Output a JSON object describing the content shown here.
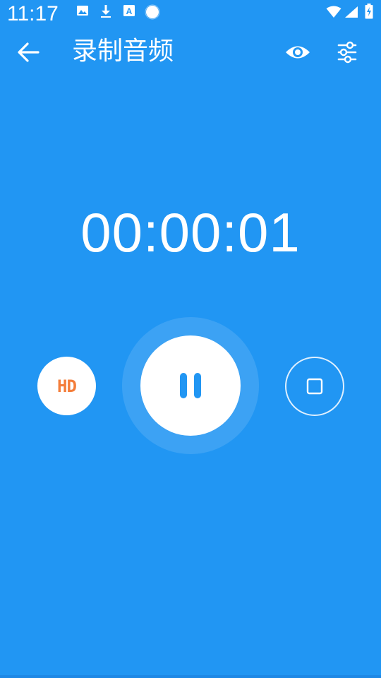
{
  "status_bar": {
    "time": "11:17",
    "icons": [
      "image-icon",
      "download-icon",
      "text-a-icon",
      "circle-dot-icon",
      "wifi-icon",
      "signal-icon",
      "battery-icon"
    ]
  },
  "app_bar": {
    "title": "录制音频",
    "back_icon": "arrow-back-icon",
    "preview_icon": "eye-icon",
    "settings_icon": "tune-icon"
  },
  "recorder": {
    "elapsed": "00:00:01",
    "quality_label": "HD",
    "pause_icon": "pause-icon",
    "stop_icon": "stop-icon"
  },
  "colors": {
    "background": "#2196F3",
    "accent_white": "#FFFFFF",
    "hd_text": "#F47D3A",
    "pause_glyph": "#2196F3"
  }
}
